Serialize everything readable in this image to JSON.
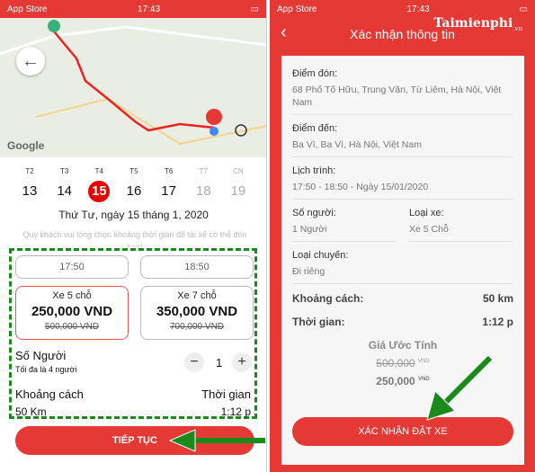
{
  "left": {
    "status": {
      "carrier": "App Store",
      "time": "17:43"
    },
    "map": {
      "attribution": "Google"
    },
    "days": [
      {
        "label": "T2",
        "num": "13"
      },
      {
        "label": "T3",
        "num": "14"
      },
      {
        "label": "T4",
        "num": "15",
        "selected": true
      },
      {
        "label": "T5",
        "num": "16"
      },
      {
        "label": "T6",
        "num": "17"
      },
      {
        "label": "T7",
        "num": "18",
        "disabled": true
      },
      {
        "label": "CN",
        "num": "19",
        "disabled": true
      }
    ],
    "date_line": "Thứ Tư, ngày 15 tháng 1, 2020",
    "hint": "Quý khách vui lòng chọn khoảng thời gian để tài xế có thể đón bạn!",
    "times": [
      "17:50",
      "18:50"
    ],
    "cars": [
      {
        "name": "Xe 5 chỗ",
        "price": "250,000 VND",
        "old": "500,000 VND",
        "selected": true
      },
      {
        "name": "Xe 7 chỗ",
        "price": "350,000 VND",
        "old": "700,000 VND"
      }
    ],
    "people_label": "Số Người",
    "people_hint": "Tối đa là 4 người",
    "people_value": "1",
    "distance_label": "Khoảng cách",
    "distance": "50 Km",
    "time_label": "Thời gian",
    "time": "1:12 p",
    "continue": "TIẾP TỤC"
  },
  "right": {
    "status": {
      "carrier": "App Store",
      "time": "17:43"
    },
    "title": "Xác nhận thông tin",
    "watermark": "Taimienphi",
    "watermark_suffix": ".vn",
    "pickup_label": "Điểm đón:",
    "pickup": "68 Phố Tố Hữu, Trung Văn, Từ Liêm, Hà Nội, Việt Nam",
    "dest_label": "Điểm đến:",
    "dest": "Ba Vì, Ba Vì, Hà Nội, Việt Nam",
    "sched_label": "Lịch trình:",
    "sched": "17:50 - 18:50 - Ngày 15/01/2020",
    "people_label": "Số người:",
    "people": "1 Người",
    "car_label": "Loại xe:",
    "car": "Xe 5 Chỗ",
    "trip_label": "Loại chuyến:",
    "trip": "Đi riêng",
    "distance_label": "Khoảng cách:",
    "distance": "50 km",
    "time_label": "Thời gian:",
    "time": "1:12 p",
    "est_label": "Giá Ước Tính",
    "old_price": "500,000",
    "price": "250,000",
    "currency": "VND",
    "confirm": "XÁC NHẬN ĐẶT XE"
  },
  "colors": {
    "accent": "#e53935",
    "highlight": "#1a8a1a"
  }
}
